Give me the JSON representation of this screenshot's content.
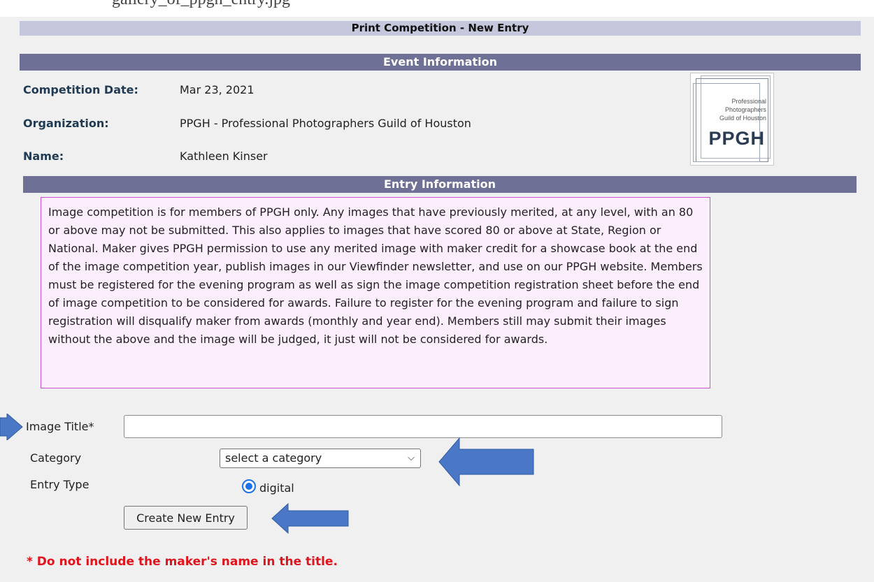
{
  "header": {
    "title": "Print Competition - New Entry"
  },
  "event_info": {
    "heading": "Event Information",
    "fields": [
      {
        "label": "Competition Date:",
        "value": "Mar 23, 2021"
      },
      {
        "label": "Organization:",
        "value": "PPGH - Professional Photographers Guild of Houston"
      },
      {
        "label": "Name:",
        "value": "Kathleen Kinser"
      }
    ],
    "logo": {
      "line1": "Professional",
      "line2": "Photographers",
      "line3": "Guild of Houston",
      "mark": "PPGH"
    }
  },
  "entry_info": {
    "heading": "Entry Information",
    "notice": "Image competition is for members of PPGH only. Any images that have previously merited, at any level, with an 80 or above may not be submitted. This also applies to images that have scored 80 or above at State, Region or National. Maker gives PPGH permission to use any merited image with maker credit for a showcase book at the end of the image competition year, publish images in our Viewfinder newsletter, and use on our PPGH website. Members must be registered for the evening program as well as sign the image competition registration sheet before the end of image competition to be considered for awards. Failure to register for the evening program and failure to sign registration will disqualify maker from awards (monthly and year end). Members still may submit their images without the above and the image will be judged, it just will not be considered for awards."
  },
  "form": {
    "image_title_label": "Image Title*",
    "image_title_value": "",
    "category_label": "Category",
    "category_selected": "select a category",
    "entry_type_label": "Entry Type",
    "entry_type_option": "digital",
    "submit_label": "Create New Entry",
    "warning": "* Do not include the maker's name in the title."
  },
  "colors": {
    "title_bar": "#c5c8dc",
    "section_bar": "#6e7095",
    "notice_bg": "#fdeefe",
    "notice_border": "#d050d6",
    "arrow": "#4a78c6",
    "warning": "#e0141c"
  },
  "icons": [
    "chevron-down-icon",
    "arrow-right-icon"
  ]
}
